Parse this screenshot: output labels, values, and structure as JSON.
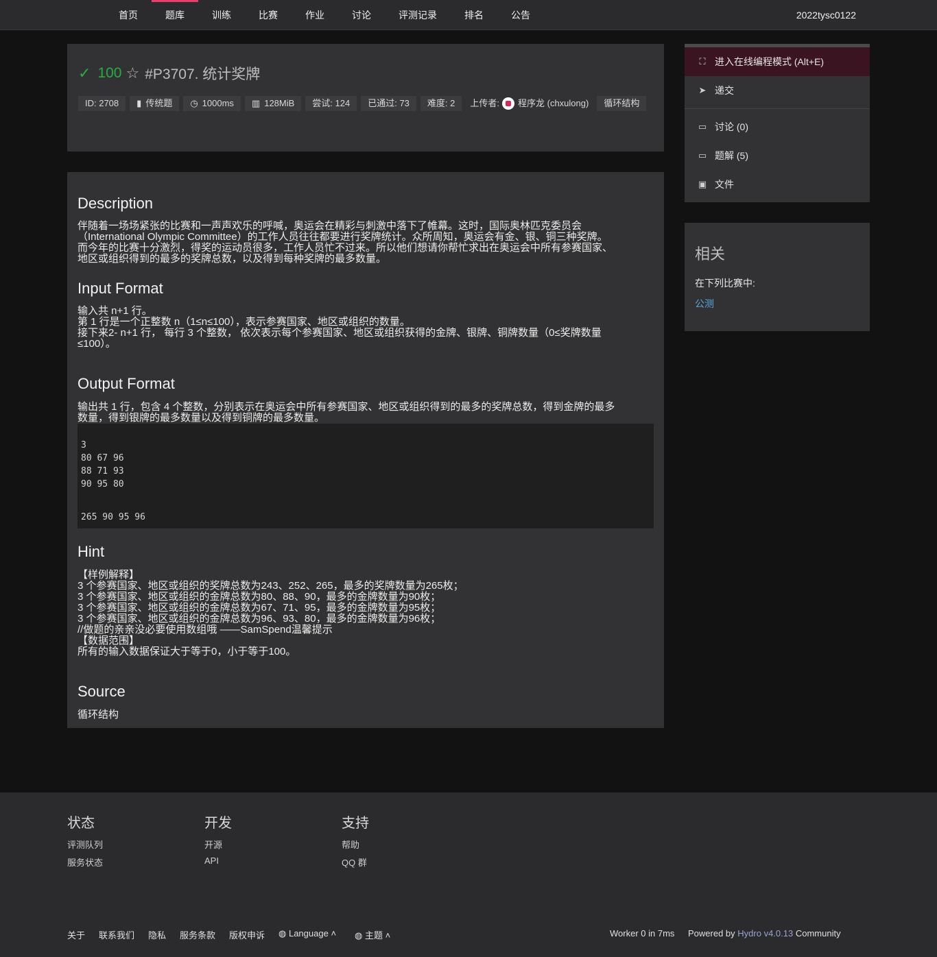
{
  "nav": {
    "items": [
      "首页",
      "题库",
      "训练",
      "比赛",
      "作业",
      "讨论",
      "评测记录",
      "排名",
      "公告"
    ],
    "active": "题库",
    "user": "2022tysc0122"
  },
  "problem": {
    "score": "100",
    "title": "#P3707. 统计奖牌",
    "tags": {
      "id": "ID: 2708",
      "type": "传统题",
      "time": "1000ms",
      "memory": "128MiB",
      "tried": "尝试: 124",
      "passed": "已通过: 73",
      "difficulty": "难度: 2",
      "uploader_label": "上传者:",
      "uploader": "程序龙 (chxulong)",
      "category": "循环结构"
    }
  },
  "content": {
    "description_h": "Description",
    "description": [
      "伴随着一场场紧张的比赛和一声声欢乐的呼喊，奥运会在精彩与刺激中落下了帷幕。这时，国际奥林匹克委员会",
      "（International Olympic Committee）的工作人员往往都要进行奖牌统计。众所周知，奥运会有金、银、铜三种奖牌。",
      "而今年的比赛十分激烈，得奖的运动员很多，工作人员忙不过来。所以他们想请你帮忙求出在奥运会中所有参赛国家、",
      "地区或组织得到的最多的奖牌总数，以及得到每种奖牌的最多数量。"
    ],
    "input_h": "Input Format",
    "input": [
      "输入共 n+1 行。",
      "第 1 行是一个正整数 n（1≤n≤100），表示参赛国家、地区或组织的数量。",
      "接下来2- n+1 行， 每行 3 个整数， 依次表示每个参赛国家、地区或组织获得的金牌、银牌、铜牌数量（0≤奖牌数量",
      "≤100）。"
    ],
    "output_h": "Output Format",
    "output": [
      "输出共 1 行，包含 4 个整数，分别表示在奥运会中所有参赛国家、地区或组织得到的最多的奖牌总数，得到金牌的最多",
      "数量，得到银牌的最多数量以及得到铜牌的最多数量。"
    ],
    "sample_input": [
      "3",
      "80 67 96",
      "88 71 93",
      "90 95 80"
    ],
    "sample_output": [
      "265 90 95 96"
    ],
    "hint_h": "Hint",
    "hint": [
      "【样例解释】",
      "3 个参赛国家、地区或组织的奖牌总数为243、252、265，最多的奖牌数量为265枚；",
      "3 个参赛国家、地区或组织的金牌总数为80、88、90，最多的金牌数量为90枚；",
      "3 个参赛国家、地区或组织的金牌总数为67、71、95，最多的金牌数量为95枚；",
      "3 个参赛国家、地区或组织的金牌总数为96、93、80，最多的金牌数量为96枚；",
      "//做题的亲亲没必要使用数组哦 ——SamSpend温馨提示",
      "【数据范围】",
      "所有的输入数据保证大于等于0，小于等于100。"
    ],
    "source_h": "Source",
    "source": "循环结构"
  },
  "sidebar": {
    "ide": "进入在线编程模式 (Alt+E)",
    "submit": "递交",
    "discuss": "讨论 (0)",
    "solutions": "题解 (5)",
    "files": "文件"
  },
  "related": {
    "title": "相关",
    "sub": "在下列比赛中:",
    "link": "公测"
  },
  "footer": {
    "cols": [
      {
        "title": "状态",
        "links": [
          "评测队列",
          "服务状态"
        ]
      },
      {
        "title": "开发",
        "links": [
          "开源",
          "API"
        ]
      },
      {
        "title": "支持",
        "links": [
          "帮助",
          "QQ 群"
        ]
      }
    ],
    "bottom_links": [
      "关于",
      "联系我们",
      "隐私",
      "服务条款",
      "版权申诉"
    ],
    "language": "Language",
    "theme": "主题",
    "worker": "Worker 0 in 7ms",
    "powered_prefix": "Powered by",
    "powered_name": "Hydro v4.0.13",
    "powered_suffix": "Community"
  },
  "colors": {
    "accent": "#e83e6c",
    "success": "#25ad40",
    "link": "#55a9e0"
  }
}
